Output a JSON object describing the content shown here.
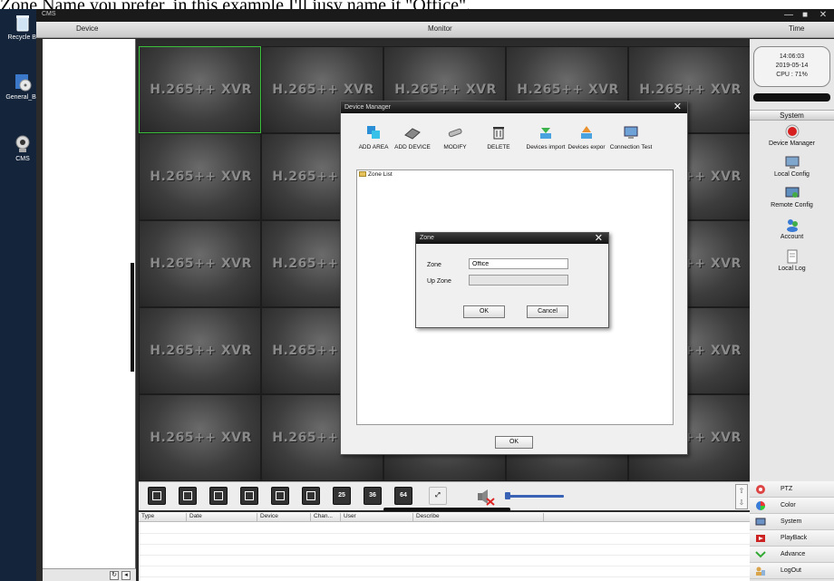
{
  "caption": "Zone Name you prefer, in this example I'll jusy name it \"Office\".",
  "desktop": {
    "icons": [
      {
        "label": "Recycle Bi",
        "icon": "recycle-bin-icon"
      },
      {
        "label": "General_Ba",
        "icon": "disc-icon"
      },
      {
        "label": "CMS",
        "icon": "webcam-icon"
      }
    ]
  },
  "window": {
    "title": "CMS",
    "controls": [
      "—",
      "■",
      "✕"
    ]
  },
  "header": {
    "device": "Device",
    "monitor": "Monitor",
    "time": "Time"
  },
  "grid": {
    "cell_text": "H.265++ XVR",
    "rows": 5,
    "cols": 5,
    "selected": 0
  },
  "status": {
    "time": "14:06:03",
    "date": "2019-05-14",
    "cpu": "CPU : 71%"
  },
  "system_menu": {
    "header": "System",
    "items": [
      {
        "label": "Device Manager",
        "icon": "red-record-icon"
      },
      {
        "label": "Local Config",
        "icon": "local-config-icon"
      },
      {
        "label": "Remote Config",
        "icon": "remote-config-icon"
      },
      {
        "label": "Account",
        "icon": "account-icon"
      },
      {
        "label": "Local Log",
        "icon": "log-icon"
      }
    ]
  },
  "layout_buttons": [
    "1",
    "4",
    "6",
    "8",
    "9",
    "16",
    "25",
    "36",
    "64"
  ],
  "log_table": {
    "headers": [
      "Type",
      "Date",
      "Device",
      "Chan...",
      "User",
      "Describe"
    ]
  },
  "right_bottom": [
    {
      "label": "PTZ",
      "icon": "ptz-icon"
    },
    {
      "label": "Color",
      "icon": "color-icon"
    },
    {
      "label": "System",
      "icon": "system-icon"
    },
    {
      "label": "PlayBack",
      "icon": "playback-icon"
    },
    {
      "label": "Advance",
      "icon": "advance-icon"
    },
    {
      "label": "LogOut",
      "icon": "logout-icon"
    }
  ],
  "device_manager": {
    "title": "Device Manager",
    "toolbar": [
      {
        "label": "ADD AREA",
        "icon": "add-area-icon"
      },
      {
        "label": "ADD DEVICE",
        "icon": "add-device-icon"
      },
      {
        "label": "MODIFY",
        "icon": "modify-icon"
      },
      {
        "label": "DELETE",
        "icon": "trash-icon"
      },
      {
        "label": "Devices import",
        "icon": "import-icon"
      },
      {
        "label": "Devices expor",
        "icon": "export-icon"
      },
      {
        "label": "Connection Test",
        "icon": "connection-test-icon"
      }
    ],
    "tree_root": "Zone List",
    "ok": "OK"
  },
  "zone_dialog": {
    "title": "Zone",
    "zone_label": "Zone",
    "zone_value": "Office",
    "up_zone_label": "Up Zone",
    "up_zone_value": "",
    "ok": "OK",
    "cancel": "Cancel"
  }
}
